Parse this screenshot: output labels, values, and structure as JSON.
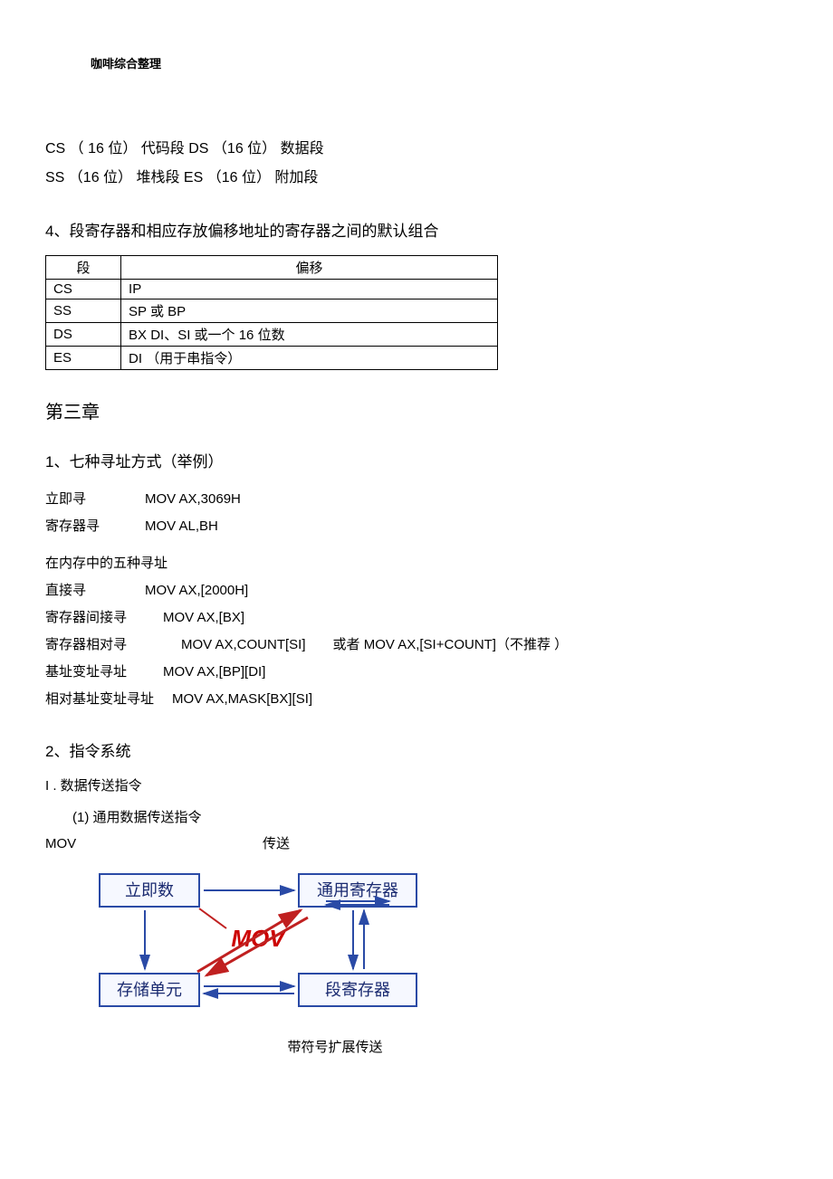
{
  "header": {
    "note": "咖啡综合整理"
  },
  "seg_desc": {
    "line1": "CS （ 16 位） 代码段  DS  （16 位） 数据段",
    "line2": "SS  （16 位） 堆栈段  ES  （16 位） 附加段"
  },
  "sec4": {
    "title": "4、段寄存器和相应存放偏移地址的寄存器之间的默认组合",
    "table": {
      "head": [
        "段",
        "偏移"
      ],
      "rows": [
        [
          "CS",
          "IP"
        ],
        [
          "SS",
          "SP 或 BP"
        ],
        [
          "DS",
          "BX DI、SI 或一个 16 位数"
        ],
        [
          "ES",
          "DI （用于串指令）"
        ]
      ]
    }
  },
  "chapter3": {
    "title": "第三章",
    "sec1": {
      "title": "1、七种寻址方式（举例）",
      "immediate": {
        "label": "立即寻",
        "code": "MOV AX,3069H"
      },
      "register": {
        "label": "寄存器寻",
        "code": "MOV AL,BH"
      },
      "mem_header": "在内存中的五种寻址",
      "rows": [
        {
          "label": "直接寻",
          "code": "MOV AX,[2000H]",
          "note": ""
        },
        {
          "label": "寄存器间接寻",
          "code": "MOV AX,[BX]",
          "note": ""
        },
        {
          "label": "寄存器相对寻",
          "code": "MOV AX,COUNT[SI]",
          "note": "或者 MOV AX,[SI+COUNT]（不推荐 ）"
        },
        {
          "label": "基址变址寻址",
          "code": "MOV AX,[BP][DI]",
          "note": ""
        },
        {
          "label": "相对基址变址寻址",
          "code": "MOV AX,MASK[BX][SI]",
          "note": ""
        }
      ]
    },
    "sec2": {
      "title": "2、指令系统",
      "sub1": "I . 数据传送指令",
      "sub1_1": "(1)    通用数据传送指令",
      "mov": {
        "name": "MOV",
        "desc": "传送"
      },
      "signed_ext": "带符号扩展传送"
    }
  },
  "diagram": {
    "box_imm": "立即数",
    "box_gen": "通用寄存器",
    "box_mem": "存储单元",
    "box_seg": "段寄存器",
    "label": "MOV"
  }
}
